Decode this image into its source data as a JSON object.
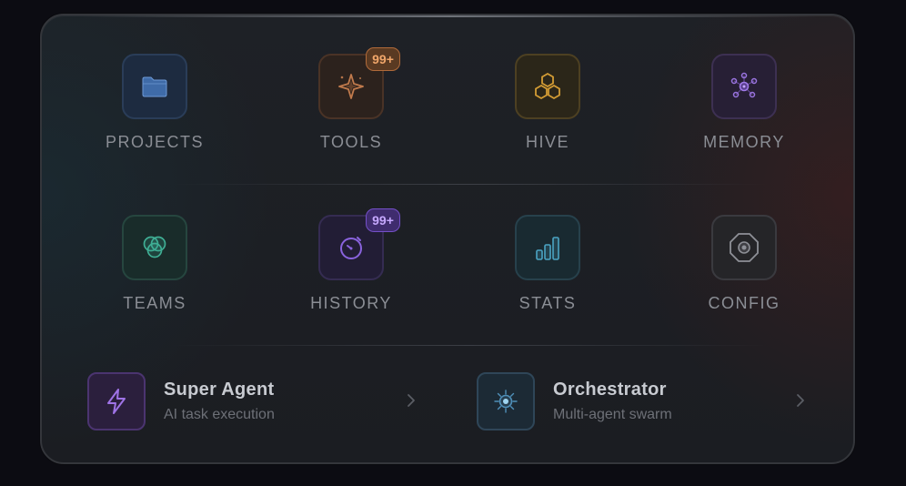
{
  "grid": {
    "row1": [
      {
        "label": "PROJECTS",
        "icon": "folder-icon",
        "badge": ""
      },
      {
        "label": "TOOLS",
        "icon": "sparkle-icon",
        "badge": "99+"
      },
      {
        "label": "HIVE",
        "icon": "hexagons-icon",
        "badge": ""
      },
      {
        "label": "MEMORY",
        "icon": "network-nodes-icon",
        "badge": ""
      }
    ],
    "row2": [
      {
        "label": "TEAMS",
        "icon": "overlapping-circles-icon",
        "badge": ""
      },
      {
        "label": "HISTORY",
        "icon": "stopwatch-icon",
        "badge": "99+"
      },
      {
        "label": "STATS",
        "icon": "bar-chart-icon",
        "badge": ""
      },
      {
        "label": "CONFIG",
        "icon": "octagon-gear-icon",
        "badge": ""
      }
    ]
  },
  "agents": [
    {
      "title": "Super Agent",
      "subtitle": "AI task execution",
      "icon": "lightning-icon"
    },
    {
      "title": "Orchestrator",
      "subtitle": "Multi-agent swarm",
      "icon": "cog-icon"
    }
  ],
  "colors": {
    "projects": "#5c8fd6",
    "tools": "#d38652",
    "hive": "#d6a23c",
    "memory": "#9670d8",
    "teams": "#3fae94",
    "history": "#8a63de",
    "stats": "#4ba4c4",
    "config": "#8e9097"
  }
}
